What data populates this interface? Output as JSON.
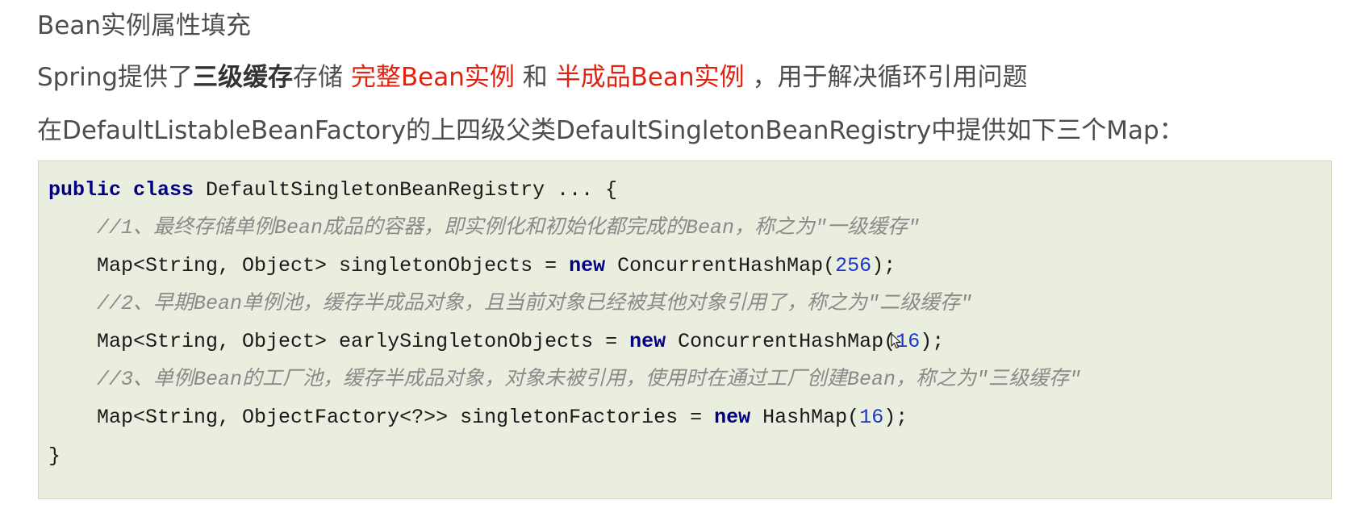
{
  "heading": "Bean实例属性填充",
  "paragraph1": {
    "prefix": "Spring提供了",
    "bold": "三级缓存",
    "middle": "存储 ",
    "highlight1": "完整Bean实例",
    "conj": " 和 ",
    "highlight2": "半成品Bean实例",
    "suffix": " ，用于解决循环引用问题"
  },
  "paragraph2": "在DefaultListableBeanFactory的上四级父类DefaultSingletonBeanRegistry中提供如下三个Map：",
  "code": {
    "line1": {
      "kw1": "public",
      "kw2": "class",
      "rest": " DefaultSingletonBeanRegistry ... {"
    },
    "comment1": "    //1、最终存储单例Bean成品的容器，即实例化和初始化都完成的Bean，称之为\"一级缓存\"",
    "line2": {
      "before": "    Map<String, Object> singletonObjects = ",
      "kw": "new",
      "after": " ConcurrentHashMap(",
      "num": "256",
      "end": ");"
    },
    "comment2": "    //2、早期Bean单例池，缓存半成品对象，且当前对象已经被其他对象引用了，称之为\"二级缓存\"",
    "line3": {
      "before": "    Map<String, Object> earlySingletonObjects = ",
      "kw": "new",
      "after": " ConcurrentHashMap(",
      "num": "16",
      "end": ");"
    },
    "comment3": "    //3、单例Bean的工厂池，缓存半成品对象，对象未被引用，使用时在通过工厂创建Bean，称之为\"三级缓存\"",
    "line4": {
      "before": "    Map<String, ObjectFactory<?>> singletonFactories = ",
      "kw": "new",
      "after": " HashMap(",
      "num": "16",
      "end": ");"
    },
    "closing": "}"
  },
  "colors": {
    "highlight": "#e2210f",
    "keyword": "#000080",
    "number": "#1a37c8",
    "comment": "#8a8a8a",
    "code_background": "#e9eede"
  },
  "icons": {
    "cursor": "mouse-pointer-icon"
  }
}
